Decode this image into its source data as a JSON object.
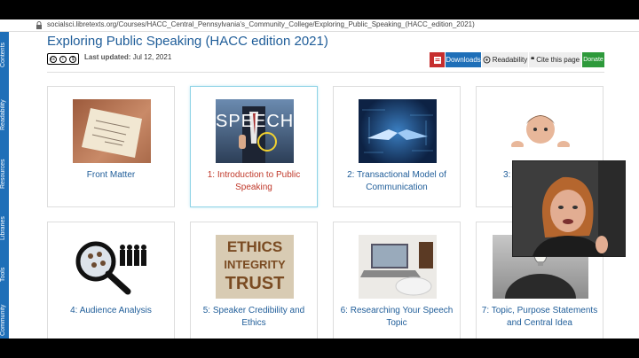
{
  "browser": {
    "url": "socialsci.libretexts.org/Courses/HACC_Central_Pennsylvania's_Community_College/Exploring_Public_Speaking_(HACC_edition_2021)"
  },
  "sidebar": {
    "tabs": [
      "Contents",
      "Readability",
      "Resources",
      "Libraries",
      "Tools",
      "Community"
    ]
  },
  "page": {
    "title": "Exploring Public Speaking (HACC edition 2021)",
    "last_updated_label": "Last updated:",
    "last_updated_value": "Jul 12, 2021"
  },
  "toolbar": {
    "downloads": "Downloads",
    "readability": "Readability",
    "cite": "Cite this page",
    "donate": "Donate"
  },
  "cards": [
    {
      "label": "Front Matter"
    },
    {
      "label": "1: Introduction to Public Speaking",
      "thumb_text": "SPEECH"
    },
    {
      "label": "2: Transactional Model of Communication"
    },
    {
      "label": "3:"
    },
    {
      "label": "4: Audience Analysis"
    },
    {
      "label": "5: Speaker Credibility and Ethics",
      "thumb_words": [
        "ETHICS",
        "INTEGRITY",
        "TRUST"
      ]
    },
    {
      "label": "6: Researching Your Speech Topic"
    },
    {
      "label": "7: Topic, Purpose Statements and Central Idea"
    }
  ],
  "colors": {
    "link": "#1f5d99",
    "active_link": "#c0392b",
    "sidebar": "#1f6fb8",
    "downloads": "#1f6fb8",
    "donate": "#2e9a3b"
  }
}
